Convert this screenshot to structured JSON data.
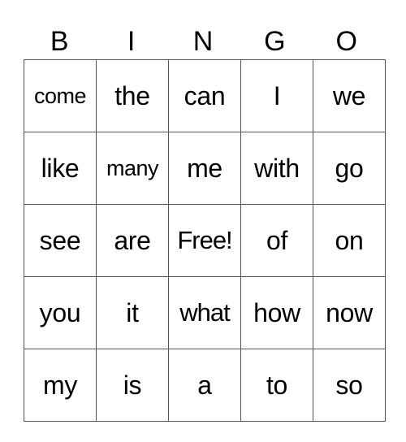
{
  "header": [
    "B",
    "I",
    "N",
    "G",
    "O"
  ],
  "rows": [
    [
      "come",
      "the",
      "can",
      "I",
      "we"
    ],
    [
      "like",
      "many",
      "me",
      "with",
      "go"
    ],
    [
      "see",
      "are",
      "Free!",
      "of",
      "on"
    ],
    [
      "you",
      "it",
      "what",
      "how",
      "now"
    ],
    [
      "my",
      "is",
      "a",
      "to",
      "so"
    ]
  ]
}
